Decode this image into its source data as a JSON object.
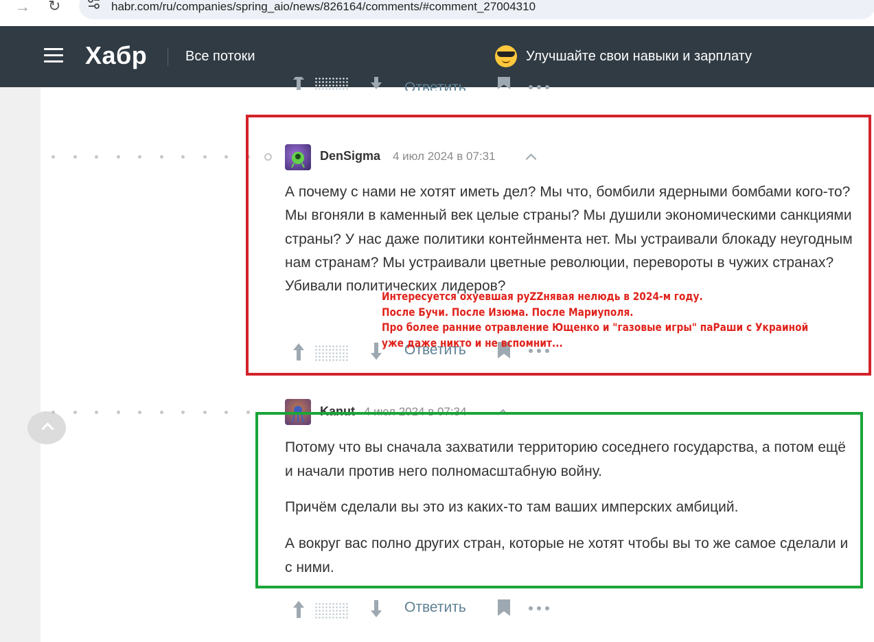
{
  "browser": {
    "url": "habr.com/ru/companies/spring_aio/news/826164/comments/#comment_27004310"
  },
  "header": {
    "logo": "Хабр",
    "streams_label": "Все потоки",
    "promo_text": "Улучшайте свои навыки и зарплату",
    "promo_icon": "sunglasses-emoji-icon",
    "bg_color": "#303b44"
  },
  "comments": [
    {
      "author": "DenSigma",
      "date": "4 июл 2024 в 07:31",
      "text": "А почему с нами не хотят иметь дел? Мы что, бомбили ядерными бомбами кого-то? Мы вгоняли в каменный век целые страны? Мы душили экономическими санкциями страны? У нас даже политики контейнмента нет. Мы устраивали блокаду неугодным нам странам? Мы устраивали цветные революции, перевороты в чужих странах? Убивали политических лидеров?",
      "reply_label": "Ответить"
    },
    {
      "author": "Kanut",
      "date": "4 июл 2024 в 07:34",
      "paragraphs": [
        "Потому что вы сначала захватили территорию соседнего государства, а потом ещё и начали против него полномасштабную войну.",
        "Причём сделали вы это из каких-то там ваших имперских амбиций.",
        "А вокруг вас полно других стран, которые не хотят чтобы вы то же самое сделали и с ними."
      ],
      "reply_label": "Ответить"
    }
  ],
  "top_actions": {
    "reply_label": "Ответить"
  },
  "annotation": {
    "lines": [
      "Интересуется охуевшая руZZнявая нелюдь в 2024-м году.",
      "После Бучи. После Изюма. После Мариуполя.",
      "Про более ранние отравление Ющенко и \"газовые игры\" паРаши с Украиной",
      "уже даже никто и не вспомнит..."
    ],
    "color": "#e0231c",
    "highlight_colors": {
      "question": "#d4222a",
      "answer": "#1aa538"
    }
  }
}
